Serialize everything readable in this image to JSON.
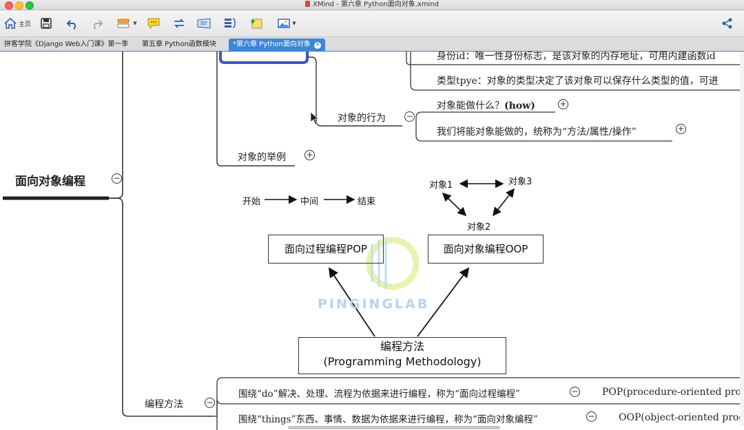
{
  "window": {
    "title": "XMind - 第六章 Python面向对象.xmind"
  },
  "toolbar": {
    "home_label": "主页",
    "icons": [
      "home-icon",
      "save-icon",
      "undo-icon",
      "redo-icon",
      "topic-style-icon",
      "comment-icon",
      "relationship-icon",
      "boundary-icon",
      "summary-icon",
      "sticky-note-icon",
      "image-icon",
      "share-icon"
    ]
  },
  "tabs": [
    {
      "label": "拼客学院《Django Web入门课》第一季",
      "active": false
    },
    {
      "label": "第五章 Python函数模块",
      "active": false
    },
    {
      "label": "*第六章 Python面向对象",
      "active": true
    }
  ],
  "map": {
    "central": "面向对象编程",
    "top_row_1": "身份id：唯一性身份标志，是该对象的内存地址，可用内建函数id",
    "top_row_2": "类型tpye：对象的类型决定了该对象可以保存什么类型的值，可进",
    "behavior": "对象的行为",
    "behavior_child_1_text": "对象能做什么？",
    "behavior_child_1_bold": "(how)",
    "behavior_child_2": "我们将能对象能做的，统称为“方法/属性/操作”",
    "examples": "对象的举例",
    "methodology": "编程方法",
    "pop_desc": "围绕“do”解决、处理、流程为依据来进行编程，称为“面向过程编程”",
    "pop_label": "POP(procedure-oriented prog",
    "oop_desc": "围绕“things”东西、事情、数据为依据来进行编程，称为“面向对象编程”",
    "oop_label": "OOP(object-oriented prog"
  },
  "diagram": {
    "start": "开始",
    "middle": "中间",
    "end": "结束",
    "obj1": "对象1",
    "obj2": "对象2",
    "obj3": "对象3",
    "pop_box": "面向过程编程POP",
    "oop_box": "面向对象编程OOP",
    "method_line1": "编程方法",
    "method_line2": "(Programming Methodology)",
    "watermark": "PINGINGLAB"
  },
  "colors": {
    "selection_blue": "#3b56c4",
    "tab_active": "#3b86d8",
    "branch_line": "#333333"
  }
}
